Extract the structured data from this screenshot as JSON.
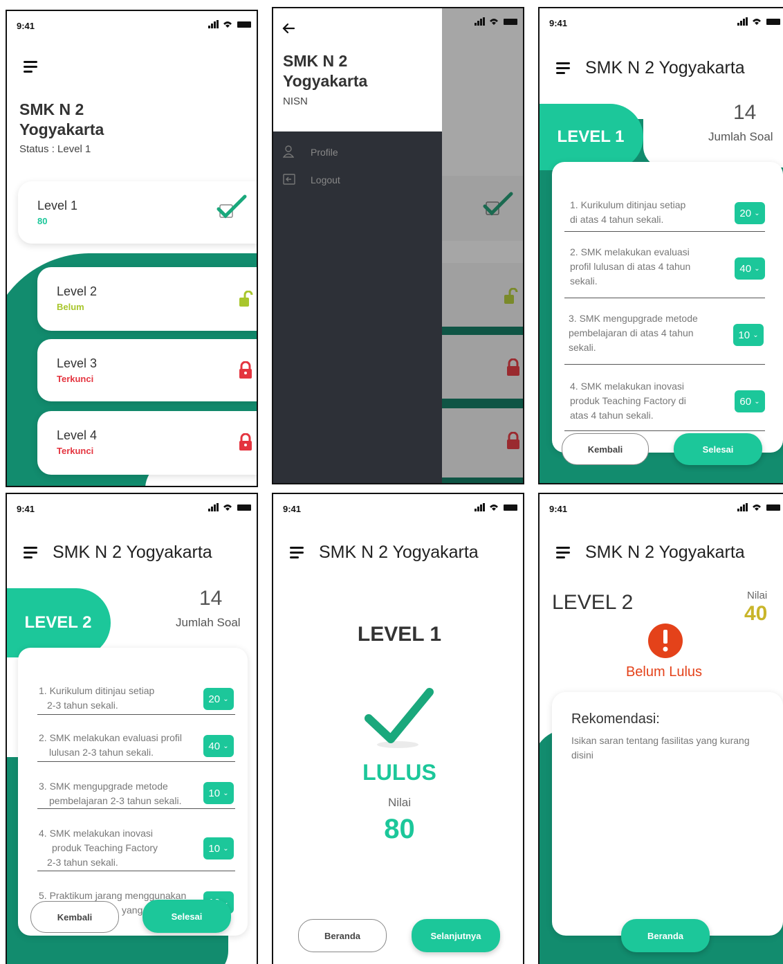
{
  "status_bar": {
    "time": "9:41"
  },
  "colors": {
    "primary": "#1cc79a",
    "dark_green": "#128c6e",
    "lime": "#a8c62c",
    "red": "#e4343f",
    "orange": "#e07a1a",
    "drawer": "#2d3037"
  },
  "screen1": {
    "school": [
      "SMK N 2",
      "Yogyakarta"
    ],
    "status": "Status : Level 1",
    "levels": [
      {
        "label": "Level 1",
        "status": "80",
        "icon": "check-icon"
      },
      {
        "label": "Level 2",
        "status": "Belum",
        "icon": "unlock-icon"
      },
      {
        "label": "Level 3",
        "status": "Terkunci",
        "icon": "lock-icon"
      },
      {
        "label": "Level 4",
        "status": "Terkunci",
        "icon": "lock-icon"
      }
    ]
  },
  "screen2": {
    "school": [
      "SMK N 2",
      "Yogyakarta"
    ],
    "nisn": "NISN",
    "menu": [
      {
        "label": "Profile",
        "icon": "user-icon"
      },
      {
        "label": "Logout",
        "icon": "logout-icon"
      }
    ]
  },
  "screen3": {
    "title": "SMK N 2 Yogyakarta",
    "level": "LEVEL 1",
    "count": "14",
    "count_label": "Jumlah Soal",
    "questions": [
      {
        "lines": [
          "1. Kurikulum ditinjau setiap",
          "di atas 4 tahun sekali."
        ],
        "score": "20"
      },
      {
        "lines": [
          "2. SMK melakukan evaluasi",
          "profil lulusan di atas 4 tahun",
          "sekali."
        ],
        "score": "40"
      },
      {
        "lines": [
          "3. SMK mengupgrade metode",
          "pembelajaran di atas 4 tahun",
          "sekali."
        ],
        "score": "10"
      },
      {
        "lines": [
          "4. SMK melakukan inovasi",
          "produk Teaching Factory di",
          "atas 4 tahun sekali."
        ],
        "score": "60"
      }
    ],
    "back": "Kembali",
    "done": "Selesai"
  },
  "screen4": {
    "title": "SMK N 2 Yogyakarta",
    "level": "LEVEL 2",
    "count": "14",
    "count_label": "Jumlah Soal",
    "questions": [
      {
        "lines": [
          "1. Kurikulum ditinjau setiap",
          "2-3 tahun sekali."
        ],
        "score": "20"
      },
      {
        "lines": [
          "2. SMK melakukan evaluasi profil",
          "lulusan 2-3 tahun sekali."
        ],
        "score": "40"
      },
      {
        "lines": [
          "3. SMK mengupgrade metode",
          "pembelajaran 2-3 tahun sekali."
        ],
        "score": "10"
      },
      {
        "lines": [
          "4. SMK melakukan inovasi",
          "produk Teaching Factory",
          "2-3 tahun sekali."
        ],
        "score": "10"
      },
      {
        "lines": [
          "5. Praktikum jarang menggunakan",
          "yang"
        ],
        "score": "10"
      }
    ],
    "back": "Kembali",
    "done": "Selesai"
  },
  "screen5": {
    "title": "SMK N 2 Yogyakarta",
    "level": "LEVEL 1",
    "result": "LULUS",
    "score_label": "Nilai",
    "score": "80",
    "home": "Beranda",
    "next": "Selanjutnya"
  },
  "screen6": {
    "title": "SMK N 2 Yogyakarta",
    "level": "LEVEL 2",
    "score_label": "Nilai",
    "score": "40",
    "result": "Belum Lulus",
    "rec_title": "Rekomendasi:",
    "rec_text": [
      "Isikan saran tentang fasilitas yang kurang",
      "disini"
    ],
    "home": "Beranda"
  }
}
